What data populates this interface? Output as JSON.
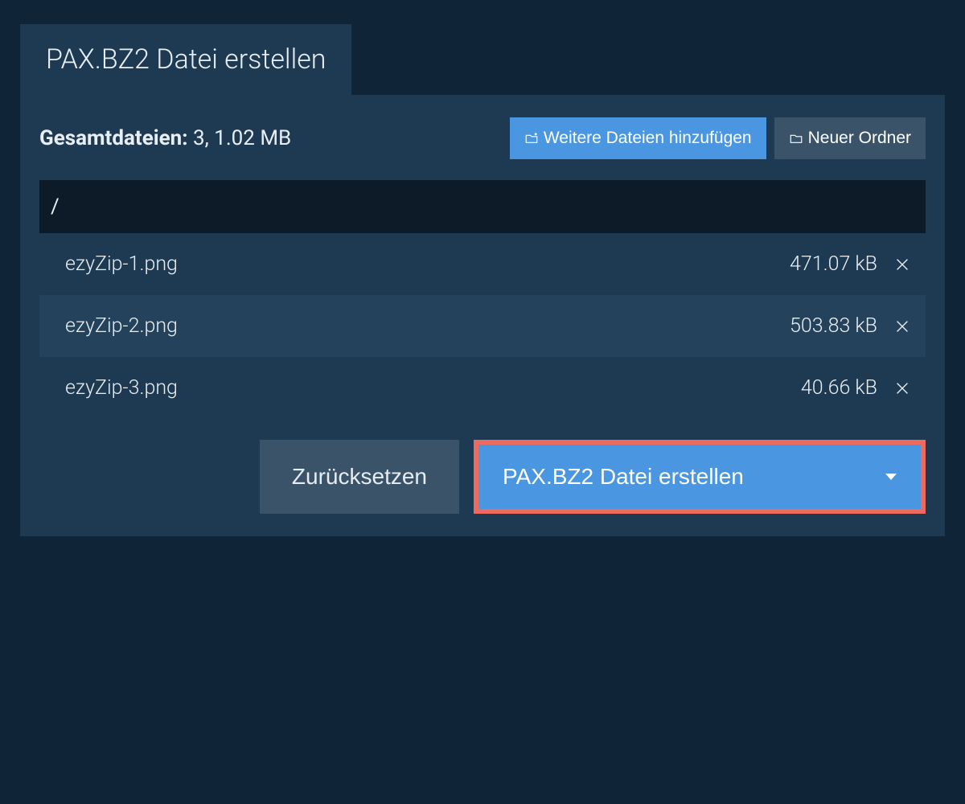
{
  "tab": {
    "title": "PAX.BZ2 Datei erstellen"
  },
  "summary": {
    "label": "Gesamtdateien:",
    "value": "3, 1.02 MB"
  },
  "buttons": {
    "add_files": "Weitere Dateien hinzufügen",
    "new_folder": "Neuer Ordner",
    "reset": "Zurücksetzen",
    "create": "PAX.BZ2 Datei erstellen"
  },
  "path": "/",
  "files": [
    {
      "name": "ezyZip-1.png",
      "size": "471.07 kB"
    },
    {
      "name": "ezyZip-2.png",
      "size": "503.83 kB"
    },
    {
      "name": "ezyZip-3.png",
      "size": "40.66 kB"
    }
  ]
}
